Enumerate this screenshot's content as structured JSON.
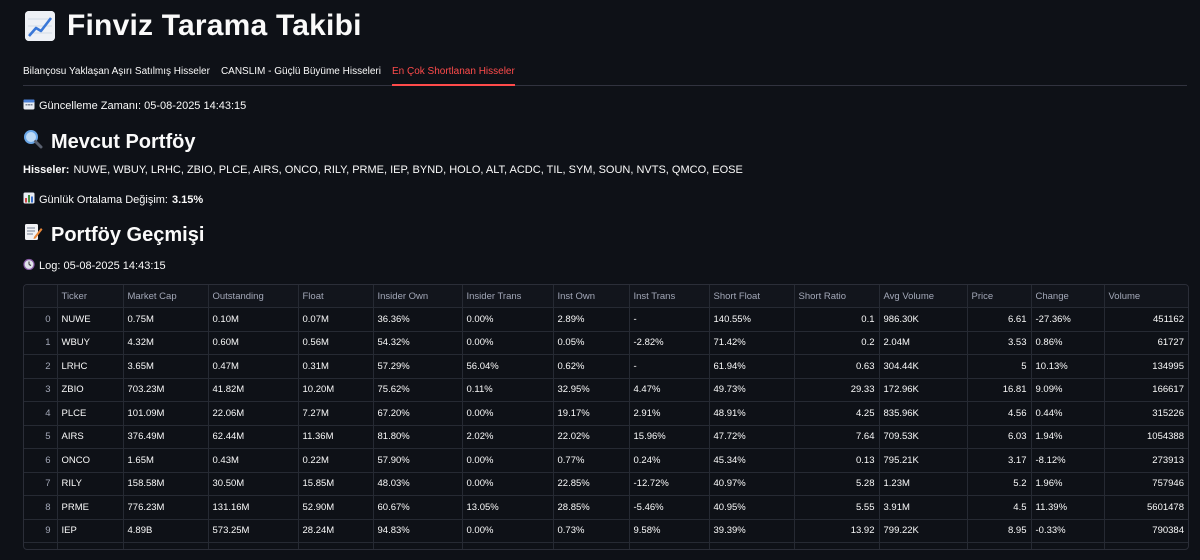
{
  "header": {
    "title": "Finviz Tarama Takibi",
    "icon": "chart-up-icon"
  },
  "tabs": [
    {
      "label": "Bilançosu Yaklaşan Aşırı Satılmış Hisseler",
      "active": false
    },
    {
      "label": "CANSLIM - Güçlü Büyüme Hisseleri",
      "active": false
    },
    {
      "label": "En Çok Shortlanan Hisseler",
      "active": true
    }
  ],
  "update": {
    "label": "Güncelleme Zamanı: 05-08-2025 14:43:15",
    "icon": "calendar-icon"
  },
  "portfolio": {
    "heading": "Mevcut Portföy",
    "icon": "magnifier-icon",
    "stocks_label": "Hisseler:",
    "stocks_value": "NUWE, WBUY, LRHC, ZBIO, PLCE, AIRS, ONCO, RILY, PRME, IEP, BYND, HOLO, ALT, ACDC, TIL, SYM, SOUN, NVTS, QMCO, EOSE",
    "avg_label": "Günlük Ortalama Değişim:",
    "avg_value": "3.15%",
    "avg_icon": "bar-chart-icon"
  },
  "history": {
    "heading": "Portföy Geçmişi",
    "icon": "memo-icon",
    "log_label": "Log: 05-08-2025 14:43:15",
    "log_icon": "clock-icon"
  },
  "table": {
    "columns": [
      "",
      "Ticker",
      "Market Cap",
      "Outstanding",
      "Float",
      "Insider Own",
      "Insider Trans",
      "Inst Own",
      "Inst Trans",
      "Short Float",
      "Short Ratio",
      "Avg Volume",
      "Price",
      "Change",
      "Volume"
    ],
    "rows": [
      [
        "0",
        "NUWE",
        "0.75M",
        "0.10M",
        "0.07M",
        "36.36%",
        "0.00%",
        "2.89%",
        "-",
        "140.55%",
        "0.1",
        "986.30K",
        "6.61",
        "-27.36%",
        "451162"
      ],
      [
        "1",
        "WBUY",
        "4.32M",
        "0.60M",
        "0.56M",
        "54.32%",
        "0.00%",
        "0.05%",
        "-2.82%",
        "71.42%",
        "0.2",
        "2.04M",
        "3.53",
        "0.86%",
        "61727"
      ],
      [
        "2",
        "LRHC",
        "3.65M",
        "0.47M",
        "0.31M",
        "57.29%",
        "56.04%",
        "0.62%",
        "-",
        "61.94%",
        "0.63",
        "304.44K",
        "5",
        "10.13%",
        "134995"
      ],
      [
        "3",
        "ZBIO",
        "703.23M",
        "41.82M",
        "10.20M",
        "75.62%",
        "0.11%",
        "32.95%",
        "4.47%",
        "49.73%",
        "29.33",
        "172.96K",
        "16.81",
        "9.09%",
        "166617"
      ],
      [
        "4",
        "PLCE",
        "101.09M",
        "22.06M",
        "7.27M",
        "67.20%",
        "0.00%",
        "19.17%",
        "2.91%",
        "48.91%",
        "4.25",
        "835.96K",
        "4.56",
        "0.44%",
        "315226"
      ],
      [
        "5",
        "AIRS",
        "376.49M",
        "62.44M",
        "11.36M",
        "81.80%",
        "2.02%",
        "22.02%",
        "15.96%",
        "47.72%",
        "7.64",
        "709.53K",
        "6.03",
        "1.94%",
        "1054388"
      ],
      [
        "6",
        "ONCO",
        "1.65M",
        "0.43M",
        "0.22M",
        "57.90%",
        "0.00%",
        "0.77%",
        "0.24%",
        "45.34%",
        "0.13",
        "795.21K",
        "3.17",
        "-8.12%",
        "273913"
      ],
      [
        "7",
        "RILY",
        "158.58M",
        "30.50M",
        "15.85M",
        "48.03%",
        "0.00%",
        "22.85%",
        "-12.72%",
        "40.97%",
        "5.28",
        "1.23M",
        "5.2",
        "1.96%",
        "757946"
      ],
      [
        "8",
        "PRME",
        "776.23M",
        "131.16M",
        "52.90M",
        "60.67%",
        "13.05%",
        "28.85%",
        "-5.46%",
        "40.95%",
        "5.55",
        "3.91M",
        "4.5",
        "11.39%",
        "5601478"
      ],
      [
        "9",
        "IEP",
        "4.89B",
        "573.25M",
        "28.24M",
        "94.83%",
        "0.00%",
        "0.73%",
        "9.58%",
        "39.39%",
        "13.92",
        "799.22K",
        "8.95",
        "-0.33%",
        "790384"
      ],
      [
        "",
        "",
        "",
        "",
        "",
        "",
        "",
        "",
        "",
        "",
        "",
        "",
        "",
        "",
        ""
      ]
    ],
    "numeric_columns": [
      10,
      12,
      14
    ]
  },
  "colors": {
    "background": "#0e1117",
    "accent": "#ff4b4b",
    "text": "#fafafa",
    "muted": "#a3a8b8"
  }
}
